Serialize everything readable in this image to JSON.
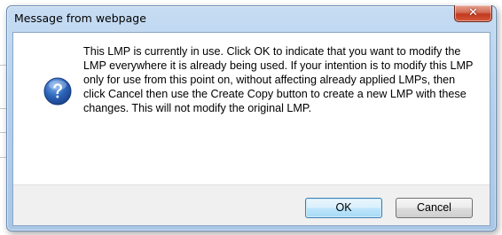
{
  "dialog": {
    "title": "Message from webpage",
    "close_icon": "close-icon",
    "message_icon": "question-icon",
    "message": "This LMP is currently in use. Click OK to indicate that you want to modify the LMP everywhere it is already being used. If your intention is to modify this LMP only for use from this point on, without affecting already applied LMPs, then click Cancel then use the Create Copy button to create a new LMP with these changes. This will not modify the original LMP.",
    "buttons": {
      "ok": "OK",
      "cancel": "Cancel"
    }
  },
  "colors": {
    "title_bar": "#b9d1ea",
    "close_button": "#c7432a",
    "question_icon": "#2a63b8",
    "ok_border": "#3c7fb1",
    "button_area": "#f0f0f0"
  }
}
